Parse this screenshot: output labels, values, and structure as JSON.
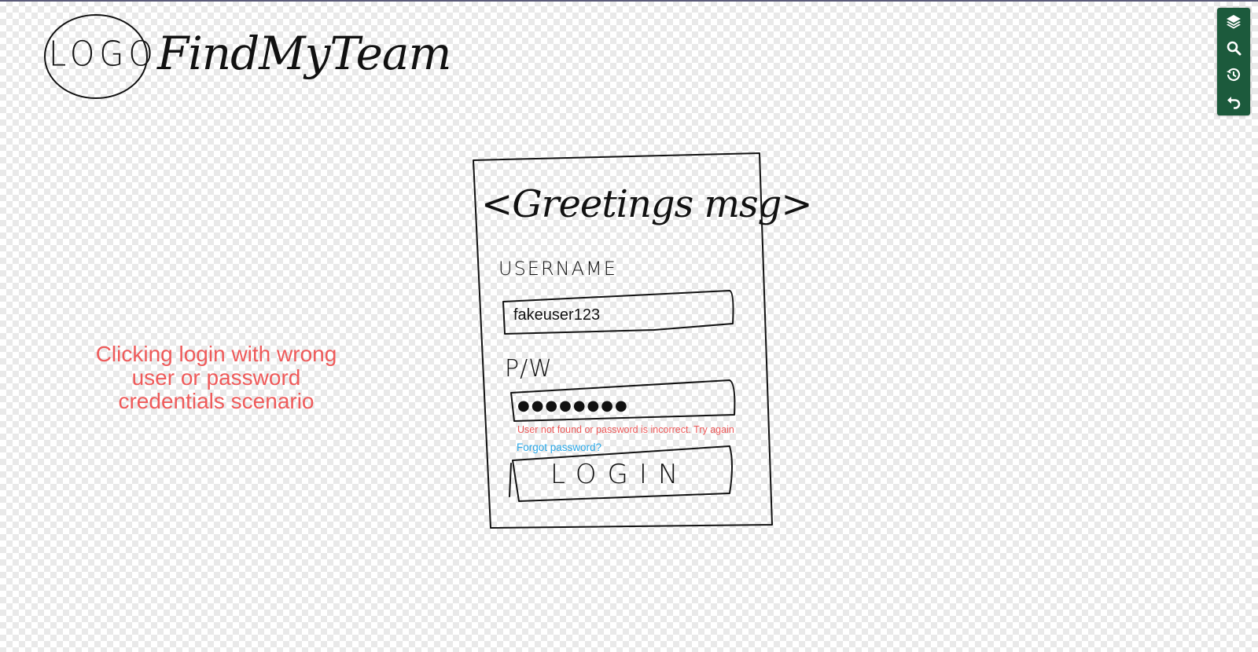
{
  "header": {
    "logo_text": "LOGO",
    "brand_name": "FindMyTeam"
  },
  "login_card": {
    "greeting": "<Greetings msg>",
    "username_label": "USERNAME",
    "username_value": "fakeuser123",
    "password_label": "P/W",
    "password_mask": "●●●●●●●●",
    "error_message": "User not found or password is incorrect. Try again",
    "forgot_password_link": "Forgot password?",
    "login_button_label": "LOGIN"
  },
  "annotation": {
    "scenario_note": "Clicking login with wrong\nuser or password\ncredentials scenario"
  },
  "toolbar": {
    "buttons": [
      {
        "icon": "layers-icon"
      },
      {
        "icon": "search-icon"
      },
      {
        "icon": "history-icon"
      },
      {
        "icon": "undo-icon"
      }
    ]
  },
  "colors": {
    "annotation_red": "#ef5a5a",
    "link_blue": "#2aa8e8",
    "toolbar_green": "#1c5a3c"
  }
}
